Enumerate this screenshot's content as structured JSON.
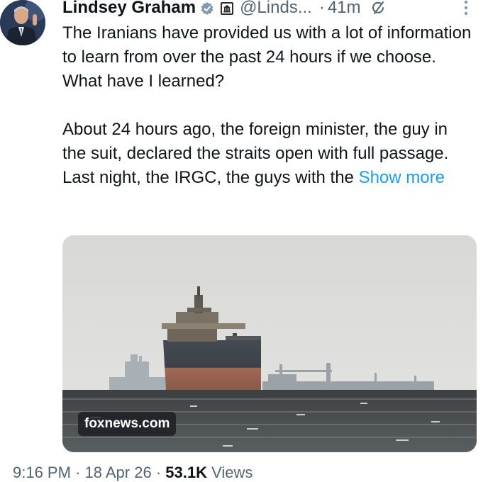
{
  "author": {
    "name": "Lindsey Graham",
    "handle": "@Linds...",
    "separator": "·",
    "time_ago": "41m"
  },
  "tweet": {
    "paragraph_1": "The Iranians have provided us with a lot of information to learn from over the past 24 hours if we choose. What have I learned?",
    "paragraph_2": "About 24 hours ago, the foreign minister, the guy in the suit, declared the straits open with full passage. Last night, the IRGC, the guys with the",
    "show_more": "Show more"
  },
  "media": {
    "watermark": "foxnews.com"
  },
  "meta": {
    "time": "9:16 PM",
    "sep1": "·",
    "date": "18 Apr 26",
    "sep2": "·",
    "views_count": "53.1K",
    "views_label": "Views"
  },
  "icons": {
    "verified": "verified-badge-icon",
    "government": "government-badge-icon",
    "grok": "grok-icon",
    "more": "more-options-icon"
  },
  "colors": {
    "link": "#1d9bf0",
    "verified": "#829aab",
    "secondary_text": "#536471"
  }
}
